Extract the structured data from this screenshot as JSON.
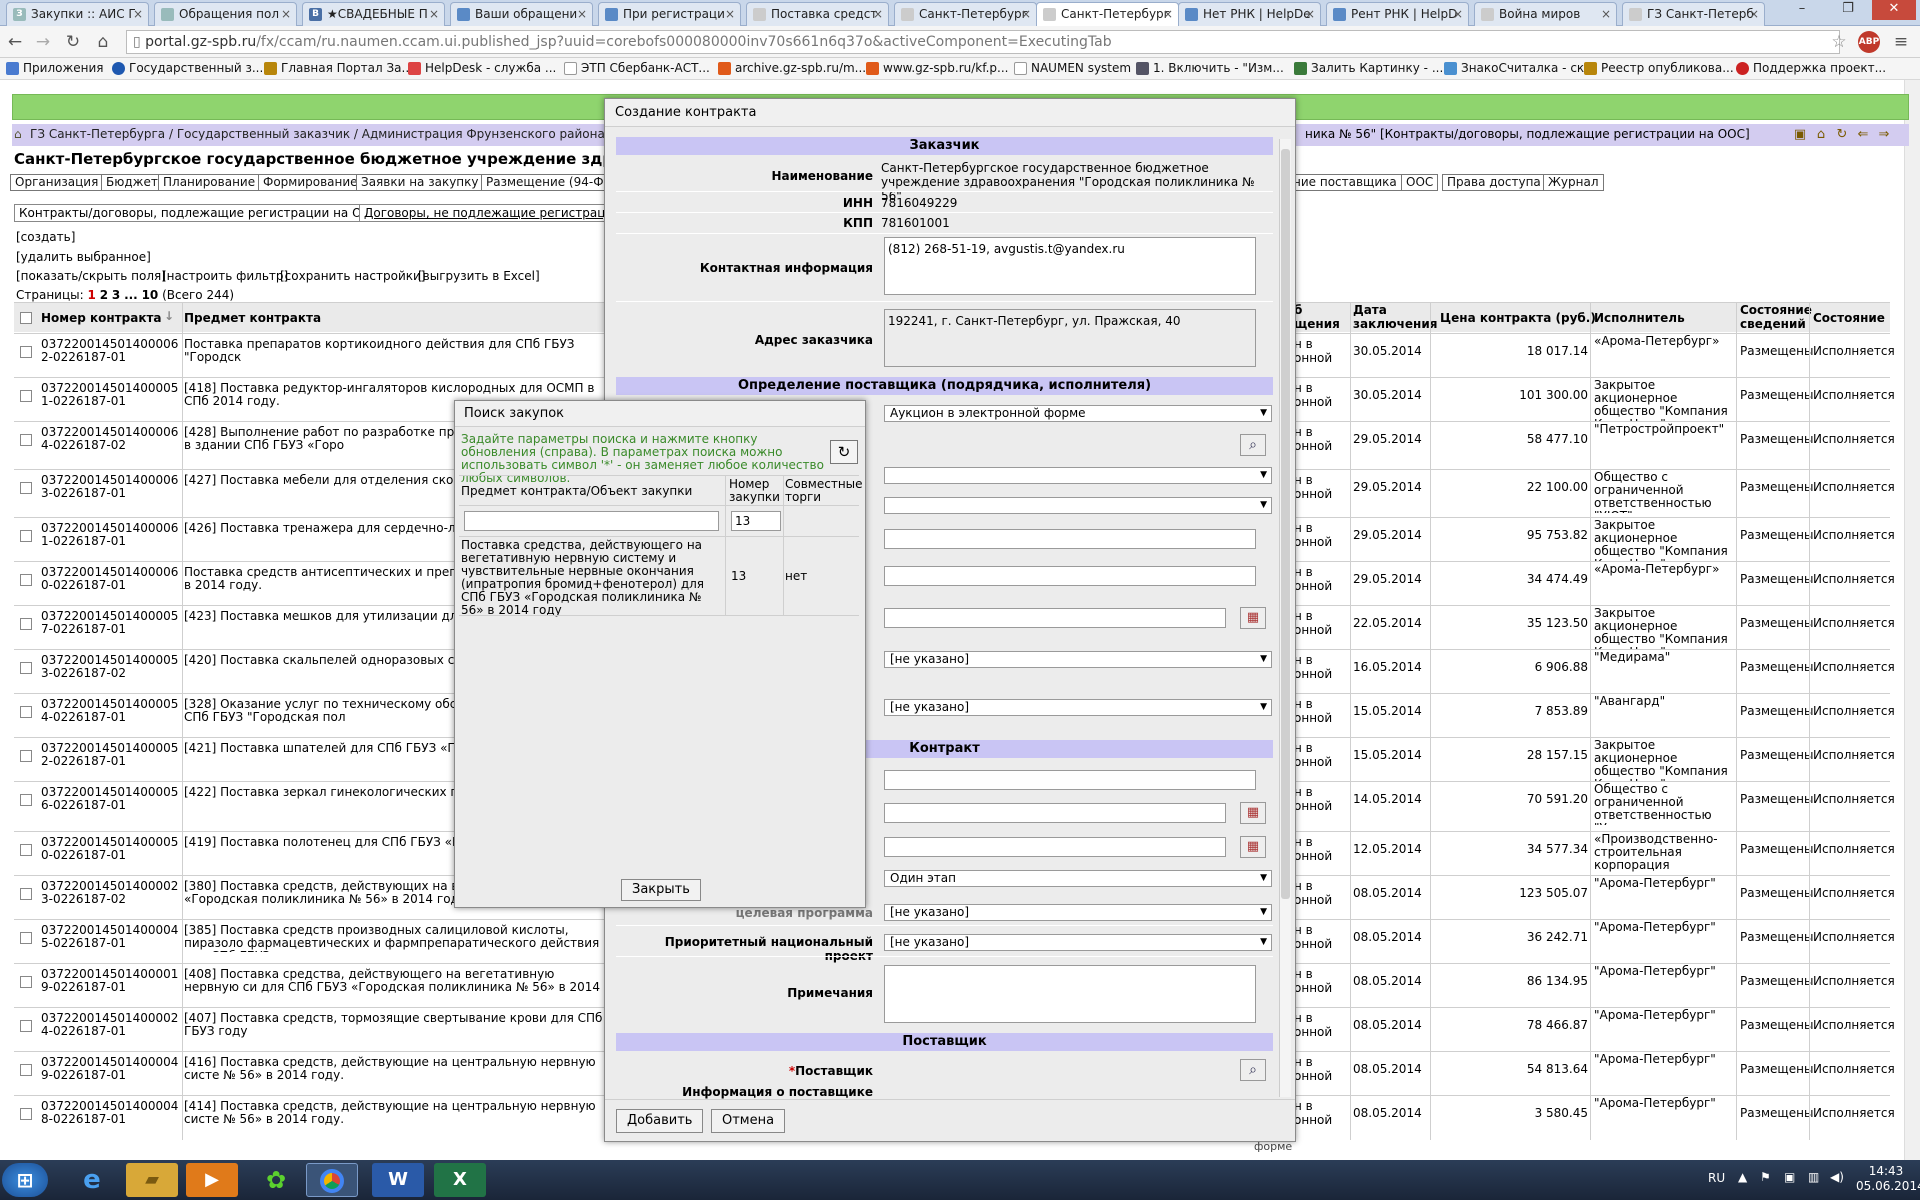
{
  "browser": {
    "tabs": [
      {
        "title": "Закупки :: АИС Г"
      },
      {
        "title": "Обращения пол"
      },
      {
        "title": "★СВАДЕБНЫЕ П"
      },
      {
        "title": "Ваши обращени"
      },
      {
        "title": "При регистраци"
      },
      {
        "title": "Поставка средст"
      },
      {
        "title": "Санкт-Петербург"
      },
      {
        "title": "Санкт-Петербург"
      },
      {
        "title": "Нет РНК | HelpDe"
      },
      {
        "title": "Рент РНК | HelpD"
      },
      {
        "title": "Война миров"
      },
      {
        "title": "ГЗ Санкт-Петерб"
      }
    ],
    "url_host": "portal.gz-spb.ru",
    "url_path": "/fx/ccam/ru.naumen.ccam.ui.published_jsp?uuid=corebofs000080000inv70s661n6q37o&activeComponent=ExecutingTab",
    "bookmarks": [
      "Приложения",
      "Государственный з...",
      "Главная Портал За...",
      "HelpDesk - служба ...",
      "ЭТП Сбербанк-АСТ...",
      "archive.gz-spb.ru/m...",
      "www.gz-spb.ru/kf.p...",
      "NAUMEN system",
      "1. Включить - \"Изм...",
      "Залить Картинку - ...",
      "ЗнакоСчиталка - ск...",
      "Реестр опубликова...",
      "Поддержка проект..."
    ]
  },
  "page": {
    "breadcrumb": "ГЗ Санкт-Петербурга / Государственный заказчик / Администрация Фрунзенского района Санк",
    "breadcrumb_tail": "ника № 56\" [Контракты/договоры, подлежащие регистрации на ООС]",
    "org_title": "Санкт-Петербургское государственное бюджетное учреждение здравоохран",
    "main_tabs_left": [
      "Организация",
      "Бюджет",
      "Планирование",
      "Формирование",
      "Заявки на закупку",
      "Размещение (94-ФЗ"
    ],
    "main_tabs_right": [
      "ние поставщика",
      "ООС",
      "Права доступа",
      "Журнал"
    ],
    "sub_tab_active": "Контракты/договоры, подлежащие регистрации на ООС",
    "sub_tab_other": "Договоры, не подлежащие регистрации",
    "actions": {
      "create": "[создать]",
      "delete": "[удалить выбранное]",
      "show_hide": "[показать/скрыть поля]",
      "filter": "[настроить фильтр]",
      "save": "[сохранить настройки]",
      "export": "[выгрузить в Excel]"
    },
    "pages": {
      "label": "Страницы:",
      "p1": "1",
      "p2": "2",
      "p3": "3",
      "dots": "...",
      "p10": "10",
      "total": "(Всего 244)"
    },
    "columns": {
      "number": "Номер контракта",
      "subject": "Предмет контракта",
      "method1": "б",
      "method2": "щения",
      "date1": "Дата",
      "date2": "заключения",
      "price": "Цена контракта (руб.)",
      "executor": "Исполнитель",
      "info1": "Состояние",
      "info2": "сведений",
      "state": "Состояние"
    },
    "rows": [
      {
        "num": "0372200145014000062-0226187-01",
        "subject": "Поставка препаратов кортикоидного действия для СПб ГБУЗ \"Городск",
        "date": "30.05.2014",
        "price": "18 017.14",
        "executor": "«Арома-Петербург»",
        "info": "Размещены",
        "state": "Исполняется"
      },
      {
        "num": "0372200145014000051-0226187-01",
        "subject": "[418] Поставка редуктор-ингаляторов кислородных для ОСМП в СПб 2014 году.",
        "date": "30.05.2014",
        "price": "101 300.00",
        "executor": "Закрытое акционерное общество \"Компания Киль-Нева\"",
        "info": "Размещены",
        "state": "Исполняется"
      },
      {
        "num": "0372200145014000064-0226187-02",
        "subject": "[428] Выполнение работ по разработке прое доступа инвалидов в здании СПб ГБУЗ «Горо",
        "date": "29.05.2014",
        "price": "58 477.10",
        "executor": "\"Петростройпроект\"",
        "info": "Размещены",
        "state": "Исполняется"
      },
      {
        "num": "0372200145014000063-0226187-01",
        "subject": "[427] Поставка мебели для отделения скоро 56» в 2014 году",
        "date": "29.05.2014",
        "price": "22 100.00",
        "executor": "Общество с ограниченной ответственностью \"УЮТ\"",
        "info": "Размещены",
        "state": "Исполняется"
      },
      {
        "num": "0372200145014000061-0226187-01",
        "subject": "[426] Поставка тренажера для сердечно-лег № 56» в 2014 году.",
        "date": "29.05.2014",
        "price": "95 753.82",
        "executor": "Закрытое акционерное общество \"Компания Киль-Нева\"",
        "info": "Размещены",
        "state": "Исполняется"
      },
      {
        "num": "0372200145014000060-0226187-01",
        "subject": "Поставка средств антисептических и препар поликлиника № 56\" в 2014 году.",
        "date": "29.05.2014",
        "price": "34 474.49",
        "executor": "«Арома-Петербург»",
        "info": "Размещены",
        "state": "Исполняется"
      },
      {
        "num": "0372200145014000057-0226187-01",
        "subject": "[423] Поставка мешков для утилизации для С",
        "date": "22.05.2014",
        "price": "35 123.50",
        "executor": "Закрытое акционерное общество \"Компания Киль-Нева\"",
        "info": "Размещены",
        "state": "Исполняется"
      },
      {
        "num": "0372200145014000053-0226187-02",
        "subject": "[420] Поставка скальпелей одноразовых сте",
        "date": "16.05.2014",
        "price": "6 906.88",
        "executor": "\"Медирама\"",
        "info": "Размещены",
        "state": "Исполняется"
      },
      {
        "num": "0372200145014000054-0226187-01",
        "subject": "[328] Оказание услуг по техническому обслу сигнализации для СПб ГБУЗ \"Городская пол",
        "date": "15.05.2014",
        "price": "7 853.89",
        "executor": "\"Авангард\"",
        "info": "Размещены",
        "state": "Исполняется"
      },
      {
        "num": "0372200145014000052-0226187-01",
        "subject": "[421] Поставка шпателей для СПб ГБУЗ «Гор",
        "date": "15.05.2014",
        "price": "28 157.15",
        "executor": "Закрытое акционерное общество \"Компания Киль-Нева\"",
        "info": "Размещены",
        "state": "Исполняется"
      },
      {
        "num": "0372200145014000056-0226187-01",
        "subject": "[422] Поставка зеркал гинекологических по",
        "date": "14.05.2014",
        "price": "70 591.20",
        "executor": "Общество с ограниченной ответственностью \"Универсалмедсервис\"",
        "info": "Размещены",
        "state": "Исполняется"
      },
      {
        "num": "0372200145014000050-0226187-01",
        "subject": "[419] Поставка полотенец для СПб ГБУЗ «Го",
        "date": "12.05.2014",
        "price": "34 577.34",
        "executor": "«Производственно-строительная корпорация максимум»",
        "info": "Размещены",
        "state": "Исполняется"
      },
      {
        "num": "0372200145014000023-0226187-02",
        "subject": "[380] Поставка средств, действующих на ве для СПб ГБУЗ «Городская поликлиника № 56» в 2014 году",
        "date": "08.05.2014",
        "price": "123 505.07",
        "executor": "\"Арома-Петербург\"",
        "info": "Размещены",
        "state": "Исполняется"
      },
      {
        "num": "0372200145014000045-0226187-01",
        "subject": "[385] Поставка средств производных салициловой кислоты, пиразоло фармацевтических и фармпрепаратического действия для СПб ГБУЗ",
        "date": "08.05.2014",
        "price": "36 242.71",
        "executor": "\"Арома-Петербург\"",
        "info": "Размещены",
        "state": "Исполняется"
      },
      {
        "num": "0372200145014000019-0226187-01",
        "subject": "[408] Поставка средства, действующего на вегетативную нервную си для СПб ГБУЗ «Городская поликлиника № 56» в 2014 году",
        "date": "08.05.2014",
        "price": "86 134.95",
        "executor": "\"Арома-Петербург\"",
        "info": "Размещены",
        "state": "Исполняется"
      },
      {
        "num": "0372200145014000024-0226187-01",
        "subject": "[407] Поставка средств, тормозящие свертывание крови для СПб ГБУЗ году",
        "date": "08.05.2014",
        "price": "78 466.87",
        "executor": "\"Арома-Петербург\"",
        "info": "Размещены",
        "state": "Исполняется"
      },
      {
        "num": "0372200145014000049-0226187-01",
        "subject": "[416] Поставка средств, действующие на центральную нервную систе № 56» в 2014 году.",
        "date": "08.05.2014",
        "price": "54 813.64",
        "executor": "\"Арома-Петербург\"",
        "info": "Размещены",
        "state": "Исполняется"
      },
      {
        "num": "0372200145014000048-0226187-01",
        "subject": "[414] Поставка средств, действующие на центральную нервную систе № 56» в 2014 году.",
        "date": "08.05.2014",
        "price": "3 580.45",
        "executor": "\"Арома-Петербург\"",
        "info": "Размещены",
        "state": "Исполняется"
      }
    ],
    "method_text1": "н в",
    "method_text2": "онной",
    "footer_word": "форме"
  },
  "contract_dialog": {
    "title": "Создание контракта",
    "sec_customer": "Заказчик",
    "name_label": "Наименование",
    "name_value": "Санкт-Петербургское государственное бюджетное учреждение здравоохранения \"Городская поликлиника № 56\"",
    "inn_label": "ИНН",
    "inn_value": "7816049229",
    "kpp_label": "КПП",
    "kpp_value": "781601001",
    "contact_label": "Контактная информация",
    "contact_value": "(812) 268-51-19, avgustis.t@yandex.ru",
    "address_label": "Адрес заказчика",
    "address_value": "192241, г. Санкт-Петербург, ул. Пражская, 40",
    "sec_supplier_def": "Определение поставщика (подрядчика, исполнителя)",
    "method_value": "Аукцион в электронной форме",
    "not_specified": "[не указано]",
    "sec_contract": "Контракт",
    "stages_value": "Один этап",
    "label_partial": "целевая программа",
    "priority_label": "Приоритетный национальный проект",
    "notes_label": "Примечания",
    "sec_supplier": "Поставщик",
    "supplier_label": "Поставщик",
    "supplier_star": "*",
    "supplier_info_label": "Информация о поставщике",
    "add_button": "Добавить",
    "cancel_button": "Отмена"
  },
  "search_dialog": {
    "title": "Поиск закупок",
    "hint": "Задайте параметры поиска и нажмите кнопку обновления (справа). В параметрах поиска можно использовать символ '*' - он заменяет любое количество любых символов.",
    "col_subject": "Предмет контракта/Объект закупки",
    "col_number": "Номер закупки",
    "col_joint": "Совместные торги",
    "filter_number": "13",
    "result_subject": "Поставка средства, действующего на вегетативную нервную систему и чувствительные нервные окончания (ипратропия бромид+фенотерол) для СПб ГБУЗ «Городская поликлиника № 56» в 2014 году",
    "result_number": "13",
    "result_joint": "нет",
    "close_button": "Закрыть"
  },
  "taskbar": {
    "lang": "RU",
    "time": "14:43",
    "date": "05.06.2014"
  }
}
